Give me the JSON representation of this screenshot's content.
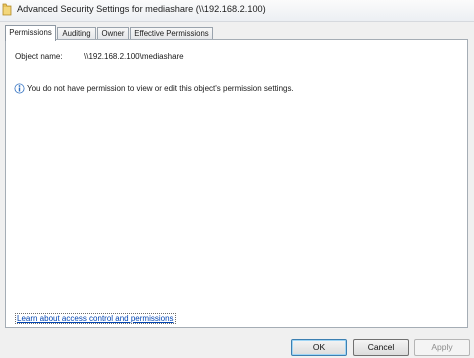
{
  "window": {
    "title": "Advanced Security Settings for mediashare (\\\\192.168.2.100)",
    "icon": "folder-icon"
  },
  "tabs": [
    {
      "label": "Permissions",
      "active": true
    },
    {
      "label": "Auditing",
      "active": false
    },
    {
      "label": "Owner",
      "active": false
    },
    {
      "label": "Effective Permissions",
      "active": false
    }
  ],
  "panel": {
    "object_label": "Object name:",
    "object_value": "\\\\192.168.2.100\\mediashare",
    "info_icon": "info-icon",
    "info_message": "You do not have permission to view or edit this object's permission settings.",
    "learn_link": "Learn about access control and permissions"
  },
  "buttons": {
    "ok": "OK",
    "cancel": "Cancel",
    "apply": "Apply",
    "apply_enabled": false
  },
  "colors": {
    "link": "#0044b3",
    "info_icon": "#2f6fc0",
    "folder": "#e8c25a"
  }
}
